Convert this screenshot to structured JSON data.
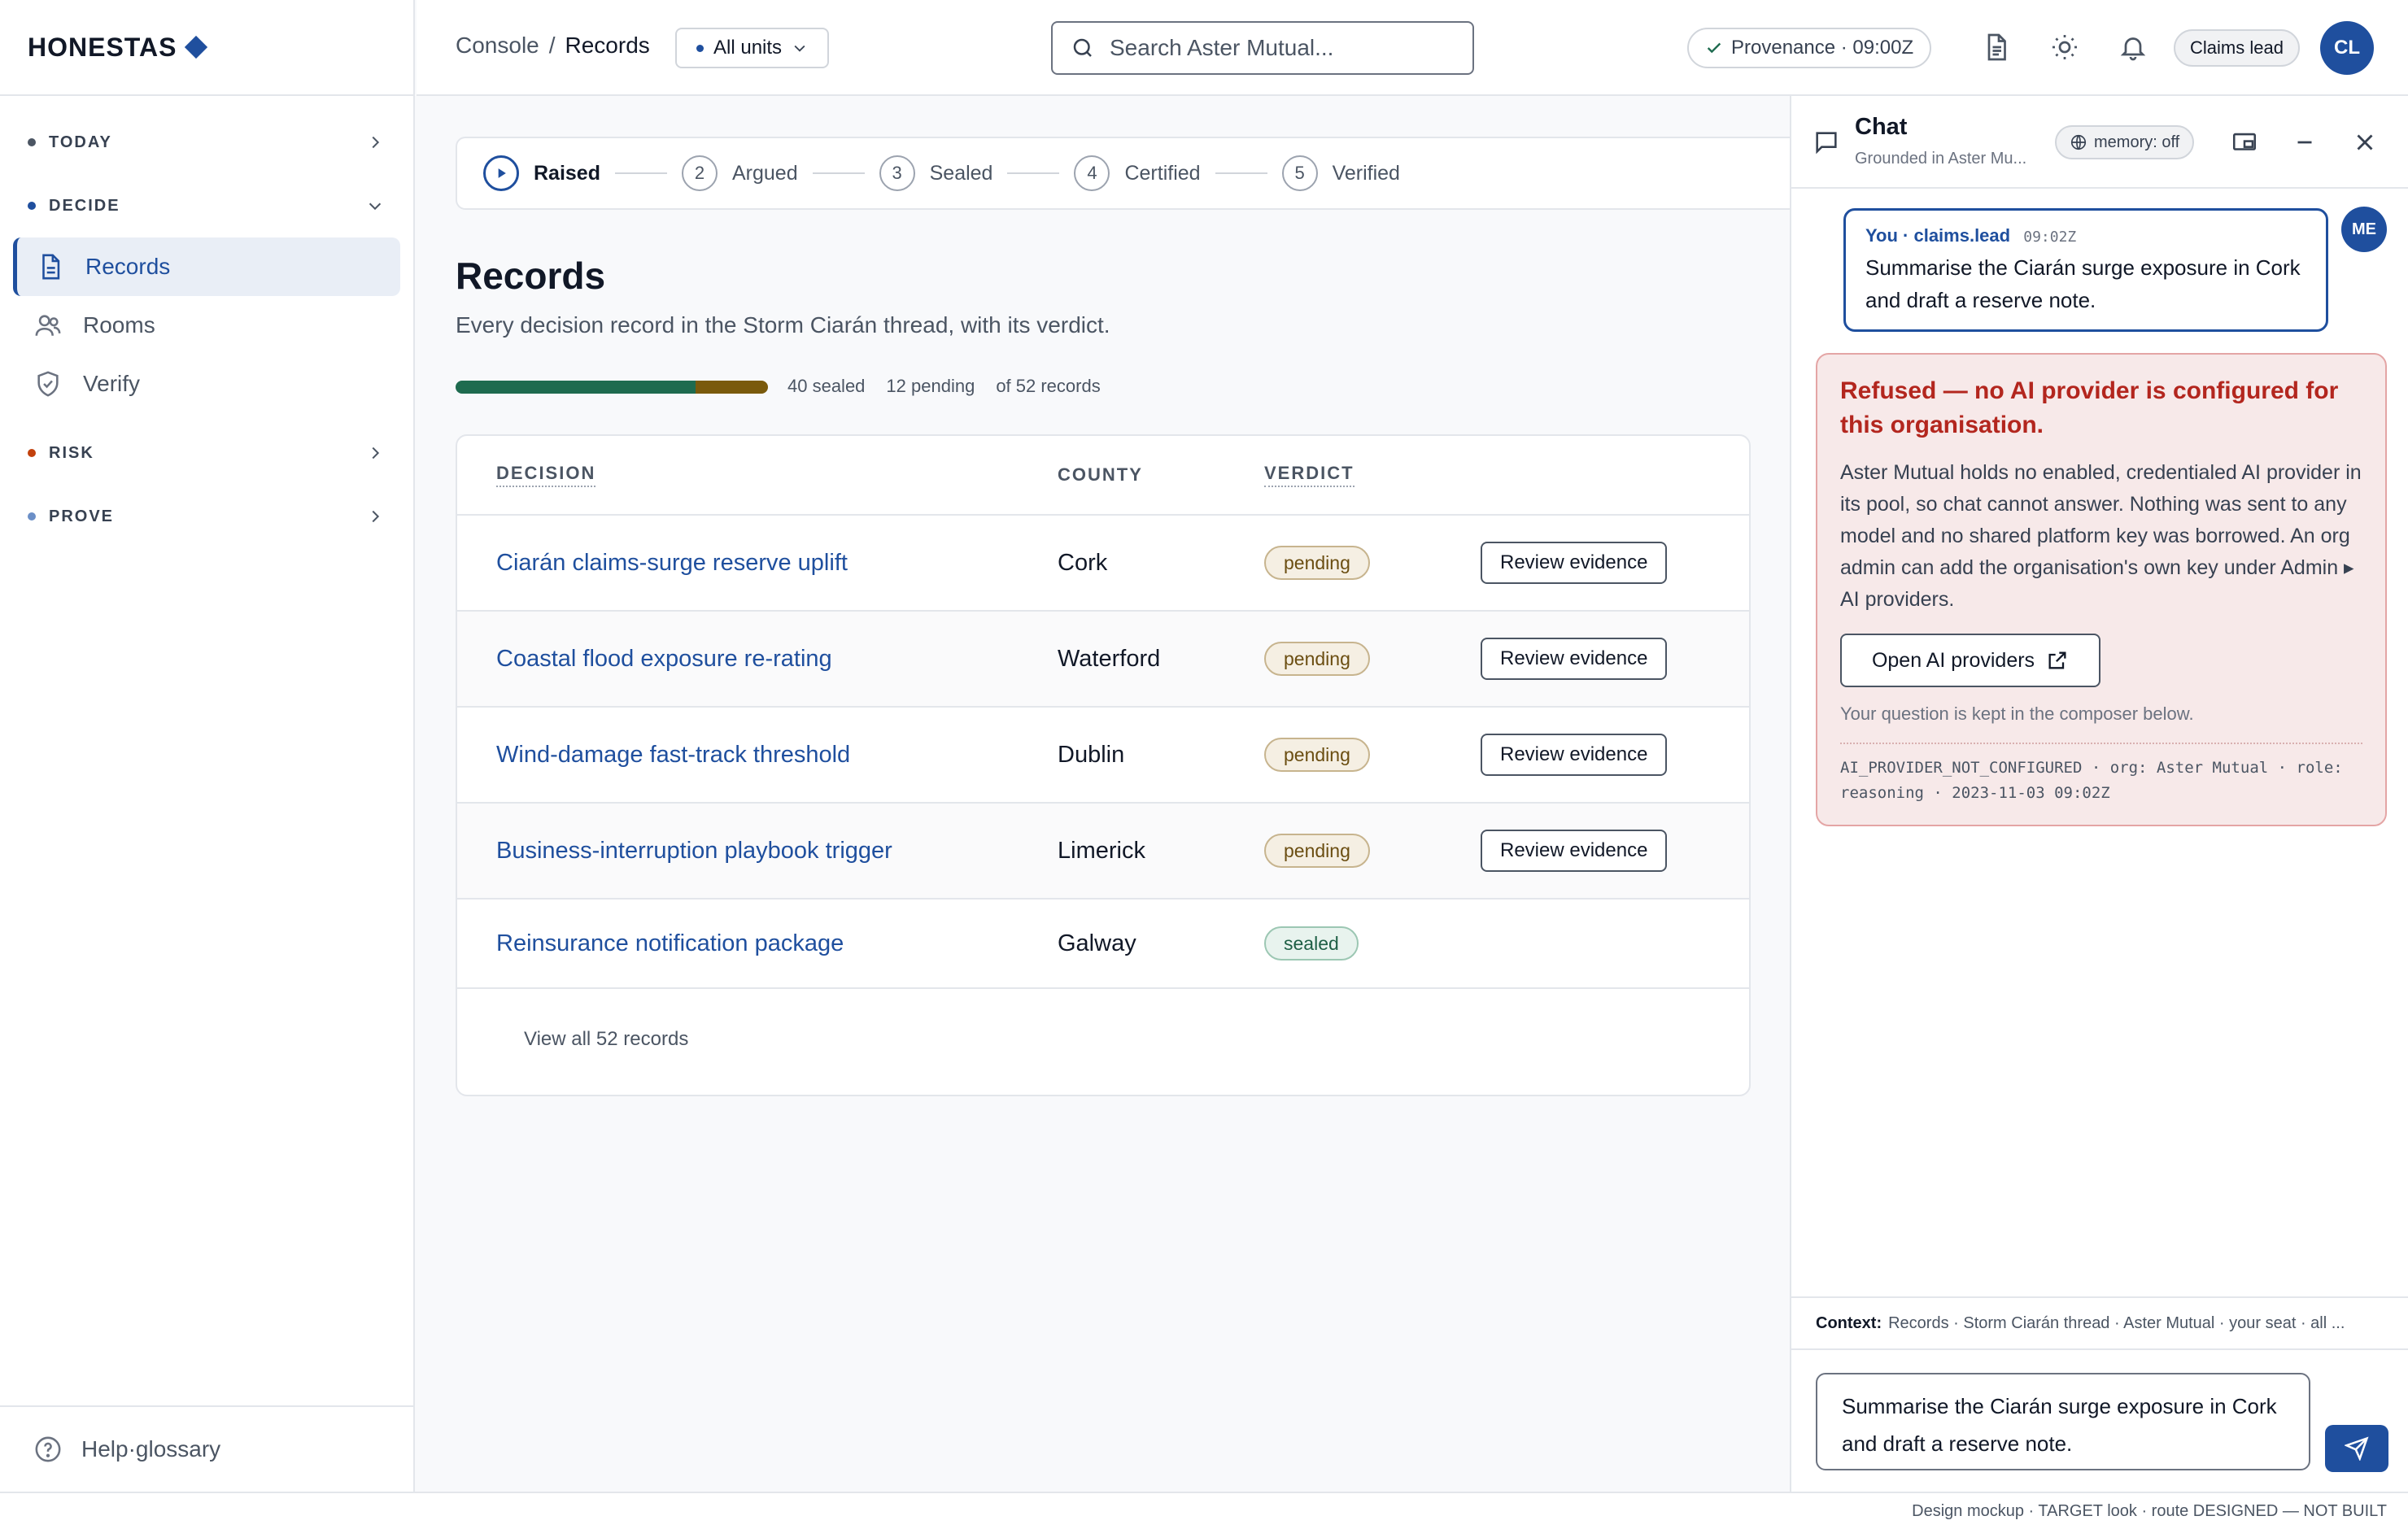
{
  "brand": {
    "name": "HONESTAS"
  },
  "sidebar": {
    "sections": [
      {
        "label": "TODAY",
        "dot_color": "#4b5563"
      },
      {
        "label": "DECIDE",
        "dot_color": "#1f4f9e"
      },
      {
        "label": "RISK",
        "dot_color": "#c2410c"
      },
      {
        "label": "PROVE",
        "dot_color": "#6b8fc7"
      }
    ],
    "items": [
      {
        "label": "Records",
        "icon": "document-icon",
        "active": true
      },
      {
        "label": "Rooms",
        "icon": "users-icon"
      },
      {
        "label": "Verify",
        "icon": "shield-check-icon"
      }
    ],
    "footer": {
      "label": "Help·glossary",
      "icon": "help-circle-icon"
    }
  },
  "topbar": {
    "breadcrumb": {
      "root": "Console",
      "separator": "/",
      "current": "Records"
    },
    "units": {
      "label": "All units"
    },
    "search": {
      "placeholder": "Search Aster Mutual..."
    },
    "provenance": {
      "label": "Provenance · 09:00Z"
    },
    "role": "Claims lead",
    "avatar": "CL"
  },
  "stepper": {
    "steps": [
      {
        "num": "",
        "label": "Raised",
        "current": true
      },
      {
        "num": "2",
        "label": "Argued"
      },
      {
        "num": "3",
        "label": "Sealed"
      },
      {
        "num": "4",
        "label": "Certified"
      },
      {
        "num": "5",
        "label": "Verified"
      }
    ]
  },
  "main": {
    "title": "Records",
    "subtitle": "Every decision record in the Storm Ciarán thread, with its verdict.",
    "progress": {
      "sealed": 40,
      "pending": 12,
      "total": 52,
      "sealed_color": "#1e6b4f",
      "pending_color": "#7a5a0c"
    },
    "stats": {
      "sealed": "40 sealed",
      "pending": "12 pending",
      "total": "of 52 records"
    },
    "table": {
      "headers": {
        "decision": "DECISION",
        "county": "COUNTY",
        "verdict": "VERDICT"
      },
      "rows": [
        {
          "decision": "Ciarán claims-surge reserve uplift",
          "county": "Cork",
          "verdict": "pending",
          "action": "Review evidence"
        },
        {
          "decision": "Coastal flood exposure re-rating",
          "county": "Waterford",
          "verdict": "pending",
          "action": "Review evidence"
        },
        {
          "decision": "Wind-damage fast-track threshold",
          "county": "Dublin",
          "verdict": "pending",
          "action": "Review evidence"
        },
        {
          "decision": "Business-interruption playbook trigger",
          "county": "Limerick",
          "verdict": "pending",
          "action": "Review evidence"
        },
        {
          "decision": "Reinsurance notification package",
          "county": "Galway",
          "verdict": "sealed",
          "action": ""
        }
      ],
      "view_all": "View all 52 records"
    }
  },
  "chat": {
    "title": "Chat",
    "subtitle": "Grounded in Aster Mu...",
    "memory": "memory: off",
    "user_message": {
      "author": "You · claims.lead",
      "time": "09:02Z",
      "text": "Summarise the Ciarán surge exposure in Cork and draft a reserve note."
    },
    "me_avatar": "ME",
    "error": {
      "title": "Refused — no AI provider is configured for this organisation.",
      "body": "Aster Mutual holds no enabled, credentialed AI provider in its pool, so chat cannot answer. Nothing was sent to any model and no shared platform key was borrowed. An org admin can add the organisation's own key under Admin ▸ AI providers.",
      "button": "Open AI providers",
      "note": "Your question is kept in the composer below.",
      "code": "AI_PROVIDER_NOT_CONFIGURED · org: Aster Mutual · role: reasoning · 2023-11-03 09:02Z"
    },
    "context": {
      "label": "Context:",
      "value": "Records · Storm Ciarán thread · Aster Mutual · your seat · all ..."
    },
    "composer": {
      "value": "Summarise the Ciarán surge exposure in Cork and draft a reserve note."
    }
  },
  "footer": {
    "note": "Design mockup · TARGET look · route DESIGNED — NOT BUILT"
  }
}
